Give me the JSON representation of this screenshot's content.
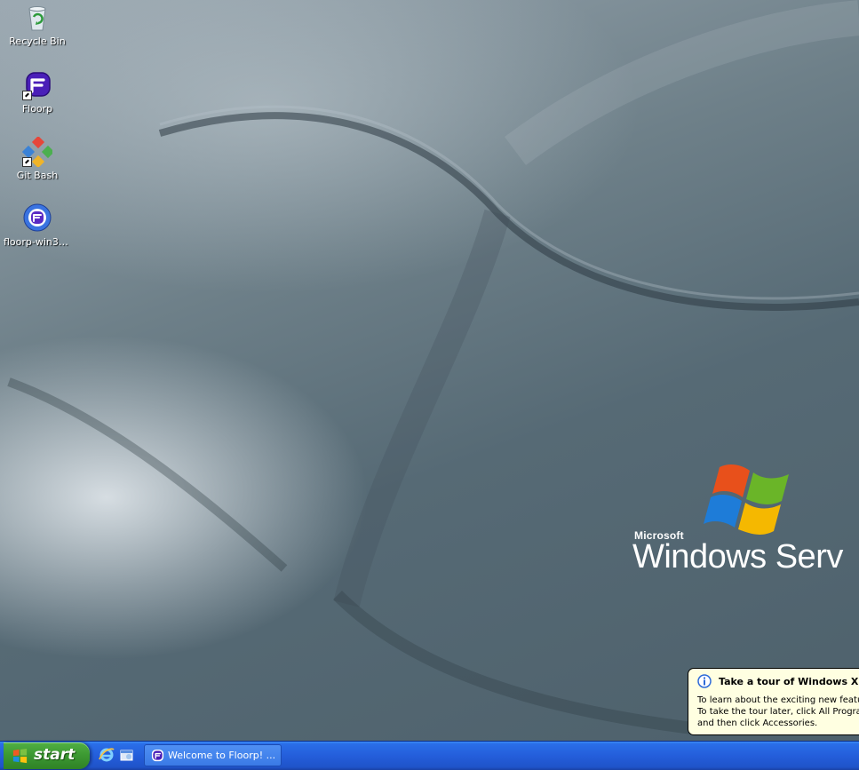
{
  "desktop": {
    "icons": [
      {
        "label": "Recycle Bin",
        "icon": "recycle-bin-icon"
      },
      {
        "label": "Floorp",
        "icon": "floorp-icon"
      },
      {
        "label": "Git Bash",
        "icon": "git-bash-icon"
      },
      {
        "label": "floorp-win32...",
        "icon": "floorp-installer-icon"
      }
    ],
    "branding": {
      "company": "Microsoft",
      "product": "Windows Serv"
    }
  },
  "balloon": {
    "title": "Take a tour of Windows XP",
    "lines": [
      "To learn about the exciting new featu",
      "To take the tour later, click All Progran",
      "and then click Accessories."
    ],
    "icon": "info-icon"
  },
  "taskbar": {
    "start_label": "start",
    "quick_launch": [
      "internet-explorer-icon",
      "show-desktop-icon"
    ],
    "task": {
      "label": "Welcome to Floorp! ...",
      "icon": "floorp-icon"
    }
  },
  "colors": {
    "taskbar_blue": "#245edb",
    "start_green": "#3d9a33",
    "balloon_bg": "#ffffe1"
  }
}
